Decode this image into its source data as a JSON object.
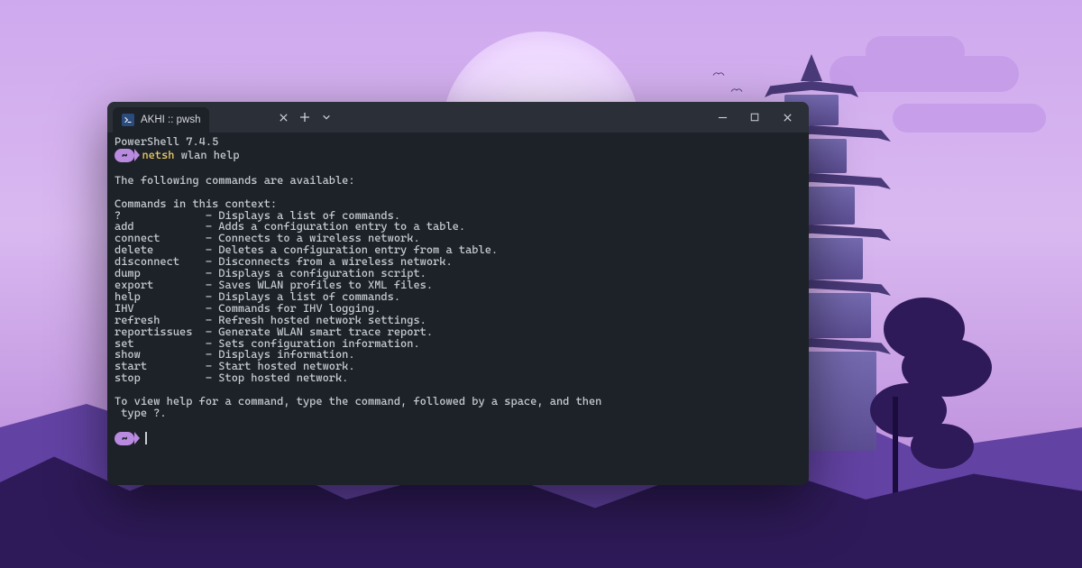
{
  "tab": {
    "title": "AKHI :: pwsh"
  },
  "header_line": "PowerShell 7.4.5",
  "prompt_symbol": "~",
  "command": {
    "name": "netsh",
    "args": "wlan help"
  },
  "output_intro": "The following commands are available:",
  "context_header": "Commands in this context:",
  "commands": [
    {
      "cmd": "?",
      "desc": "Displays a list of commands."
    },
    {
      "cmd": "add",
      "desc": "Adds a configuration entry to a table."
    },
    {
      "cmd": "connect",
      "desc": "Connects to a wireless network."
    },
    {
      "cmd": "delete",
      "desc": "Deletes a configuration entry from a table."
    },
    {
      "cmd": "disconnect",
      "desc": "Disconnects from a wireless network."
    },
    {
      "cmd": "dump",
      "desc": "Displays a configuration script."
    },
    {
      "cmd": "export",
      "desc": "Saves WLAN profiles to XML files."
    },
    {
      "cmd": "help",
      "desc": "Displays a list of commands."
    },
    {
      "cmd": "IHV",
      "desc": "Commands for IHV logging."
    },
    {
      "cmd": "refresh",
      "desc": "Refresh hosted network settings."
    },
    {
      "cmd": "reportissues",
      "desc": "Generate WLAN smart trace report."
    },
    {
      "cmd": "set",
      "desc": "Sets configuration information."
    },
    {
      "cmd": "show",
      "desc": "Displays information."
    },
    {
      "cmd": "start",
      "desc": "Start hosted network."
    },
    {
      "cmd": "stop",
      "desc": "Stop hosted network."
    }
  ],
  "footer_line1": "To view help for a command, type the command, followed by a space, and then",
  "footer_line2": " type ?."
}
